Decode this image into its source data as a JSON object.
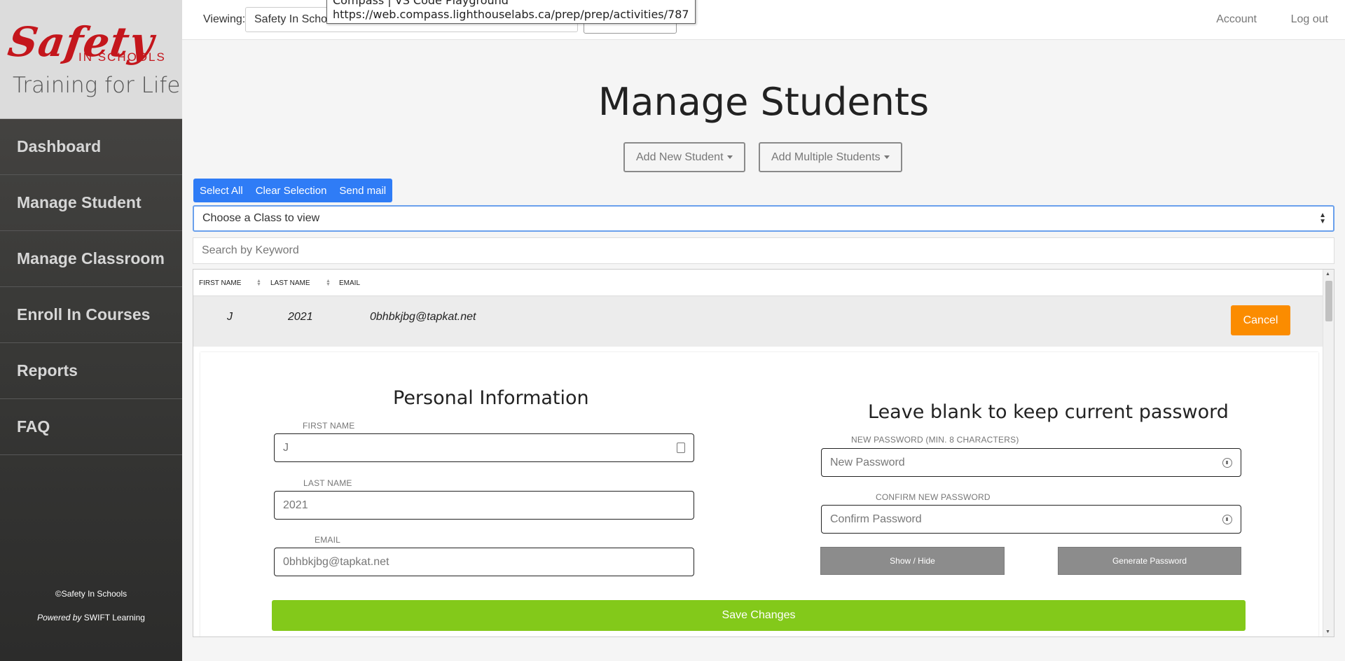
{
  "sidebar": {
    "logo": {
      "brand": "Safety",
      "sub": "IN SCHOOLS",
      "tagline": "Training for Life",
      "brand_color": "#c4161c"
    },
    "items": [
      {
        "label": "Dashboard"
      },
      {
        "label": "Manage Student"
      },
      {
        "label": "Manage Classroom"
      },
      {
        "label": "Enroll In Courses"
      },
      {
        "label": "Reports"
      },
      {
        "label": "FAQ"
      }
    ],
    "copyright": "©Safety In Schools",
    "powered_prefix": "Powered by",
    "powered_name": "SWIFT Learning"
  },
  "topbar": {
    "viewing_label": "Viewing:",
    "viewing_value": "Safety In Scho",
    "account": "Account",
    "logout": "Log out"
  },
  "tooltip": {
    "line1": "Compass | VS Code Playground",
    "line2": "https://web.compass.lighthouselabs.ca/prep/prep/activities/787"
  },
  "main": {
    "title": "Manage Students",
    "add_new_student": "Add New Student",
    "add_multiple_students": "Add Multiple Students",
    "bulk": {
      "select_all": "Select All",
      "clear_selection": "Clear Selection",
      "send_mail": "Send mail",
      "color": "#2f7cf6"
    },
    "class_select": "Choose a Class to view",
    "search_placeholder": "Search by Keyword"
  },
  "table": {
    "columns": [
      "FIRST NAME",
      "LAST NAME",
      "EMAIL"
    ],
    "row": {
      "first": "J",
      "last": "2021",
      "email": "0bhbkjbg@tapkat.net"
    },
    "cancel": "Cancel",
    "cancel_color": "#fb8c00"
  },
  "edit": {
    "personal_title": "Personal Information",
    "first_label": "FIRST NAME",
    "first_value": "J",
    "last_label": "LAST NAME",
    "last_value": "2021",
    "email_label": "EMAIL",
    "email_value": "0bhbkjbg@tapkat.net",
    "password_title": "Leave blank to keep current password",
    "new_pw_label": "NEW PASSWORD (MIN. 8 CHARACTERS)",
    "new_pw_placeholder": "New Password",
    "confirm_label": "CONFIRM NEW PASSWORD",
    "confirm_placeholder": "Confirm Password",
    "show_hide": "Show / Hide",
    "generate": "Generate Password",
    "save": "Save Changes",
    "save_color": "#83c91a"
  }
}
